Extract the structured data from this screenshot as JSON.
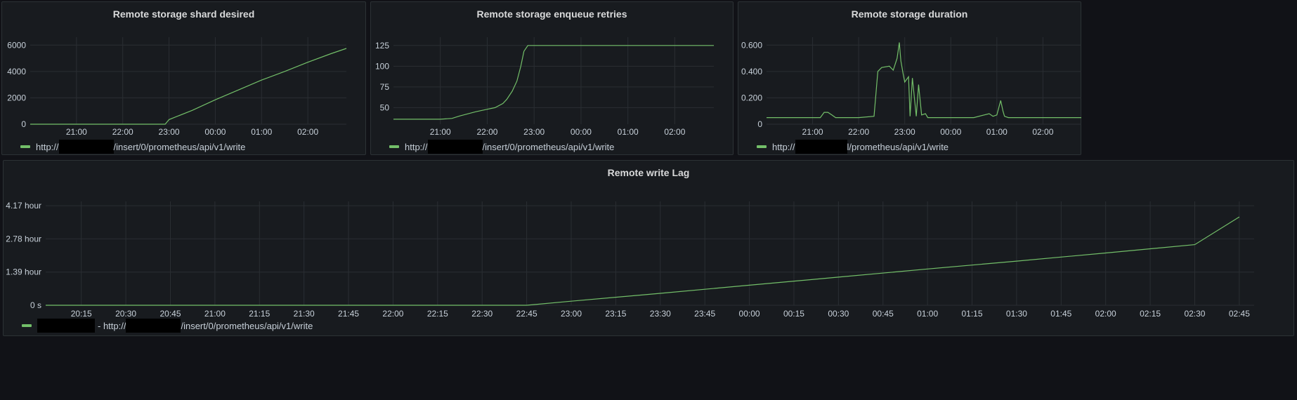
{
  "panels": [
    {
      "id": "shard",
      "title": "Remote storage shard desired",
      "legend": {
        "prefix": "http://",
        "suffix": "/insert/0/prometheus/api/v1/write"
      },
      "chart_data": {
        "type": "line",
        "title": "Remote storage shard desired",
        "xlabel": "",
        "ylabel": "",
        "x_ticks": [
          "21:00",
          "22:00",
          "23:00",
          "00:00",
          "01:00",
          "02:00"
        ],
        "y_ticks": [
          "0",
          "2000",
          "4000",
          "6000"
        ],
        "xlim": [
          "20:00",
          "02:50"
        ],
        "ylim": [
          0,
          6600
        ],
        "grid": true,
        "series": [
          {
            "x": [
              "20:00",
              "21:00",
              "22:00",
              "22:40",
              "22:55",
              "23:00",
              "23:30",
              "00:00",
              "00:30",
              "01:00",
              "01:30",
              "02:00",
              "02:30",
              "02:50"
            ],
            "y": [
              0,
              0,
              0,
              0,
              0,
              350,
              1050,
              1850,
              2600,
              3350,
              4000,
              4700,
              5350,
              5750
            ]
          }
        ]
      }
    },
    {
      "id": "retries",
      "title": "Remote storage enqueue retries",
      "legend": {
        "prefix": "http://",
        "suffix": "/insert/0/prometheus/api/v1/write"
      },
      "chart_data": {
        "type": "line",
        "title": "Remote storage enqueue retries",
        "xlabel": "",
        "ylabel": "",
        "x_ticks": [
          "21:00",
          "22:00",
          "23:00",
          "00:00",
          "01:00",
          "02:00"
        ],
        "y_ticks": [
          "50",
          "75",
          "100",
          "125"
        ],
        "xlim": [
          "20:00",
          "02:50"
        ],
        "ylim": [
          30,
          135
        ],
        "grid": true,
        "series": [
          {
            "x": [
              "20:00",
              "21:00",
              "21:15",
              "21:25",
              "21:45",
              "22:00",
              "22:10",
              "22:20",
              "22:25",
              "22:32",
              "22:38",
              "22:43",
              "22:47",
              "22:52",
              "23:00",
              "00:00",
              "01:00",
              "02:00",
              "02:50"
            ],
            "y": [
              36,
              36,
              37,
              40,
              45,
              48,
              50,
              55,
              60,
              70,
              82,
              100,
              118,
              125,
              125,
              125,
              125,
              125,
              125
            ]
          }
        ]
      }
    },
    {
      "id": "duration",
      "title": "Remote storage duration",
      "legend": {
        "prefix": "http://",
        "suffix": "l/prometheus/api/v1/write"
      },
      "chart_data": {
        "type": "line",
        "title": "Remote storage duration",
        "xlabel": "",
        "ylabel": "",
        "x_ticks": [
          "21:00",
          "22:00",
          "23:00",
          "00:00",
          "01:00",
          "02:00"
        ],
        "y_ticks": [
          "0",
          "0.200",
          "0.400",
          "0.600"
        ],
        "xlim": [
          "20:00",
          "02:50"
        ],
        "ylim": [
          0,
          0.66
        ],
        "grid": true,
        "series": [
          {
            "x": [
              "20:00",
              "20:30",
              "21:00",
              "21:10",
              "21:15",
              "21:20",
              "21:25",
              "21:30",
              "21:40",
              "22:00",
              "22:20",
              "22:25",
              "22:30",
              "22:40",
              "22:45",
              "22:50",
              "22:53",
              "22:55",
              "22:58",
              "23:00",
              "23:05",
              "23:07",
              "23:10",
              "23:15",
              "23:18",
              "23:22",
              "23:27",
              "23:30",
              "23:40",
              "00:00",
              "00:30",
              "00:50",
              "00:55",
              "01:00",
              "01:05",
              "01:08",
              "01:10",
              "01:15",
              "01:30",
              "02:00",
              "02:50"
            ],
            "y": [
              0.05,
              0.05,
              0.05,
              0.05,
              0.09,
              0.09,
              0.07,
              0.05,
              0.05,
              0.05,
              0.06,
              0.4,
              0.43,
              0.44,
              0.41,
              0.5,
              0.62,
              0.48,
              0.38,
              0.32,
              0.36,
              0.06,
              0.35,
              0.06,
              0.3,
              0.07,
              0.08,
              0.05,
              0.05,
              0.05,
              0.05,
              0.08,
              0.06,
              0.07,
              0.18,
              0.1,
              0.06,
              0.05,
              0.05,
              0.05,
              0.05
            ]
          }
        ]
      }
    },
    {
      "id": "lag",
      "title": "Remote write Lag",
      "legend": {
        "prefix": "- http://",
        "suffix": "/insert/0/prometheus/api/v1/write"
      },
      "chart_data": {
        "type": "line",
        "title": "Remote write Lag",
        "xlabel": "",
        "ylabel": "",
        "x_ticks": [
          "20:15",
          "20:30",
          "20:45",
          "21:00",
          "21:15",
          "21:30",
          "21:45",
          "22:00",
          "22:15",
          "22:30",
          "22:45",
          "23:00",
          "23:15",
          "23:30",
          "23:45",
          "00:00",
          "00:15",
          "00:30",
          "00:45",
          "01:00",
          "01:15",
          "01:30",
          "01:45",
          "02:00",
          "02:15",
          "02:30",
          "02:45"
        ],
        "y_ticks": [
          "0 s",
          "1.39 hour",
          "2.78 hour",
          "4.17 hour"
        ],
        "xlim": [
          "20:03",
          "02:50"
        ],
        "ylim": [
          0,
          4.35
        ],
        "grid": true,
        "series": [
          {
            "x": [
              "20:03",
              "22:45",
              "23:00",
              "23:30",
              "00:00",
              "00:30",
              "01:00",
              "01:30",
              "02:00",
              "02:30",
              "02:45"
            ],
            "y": [
              0,
              0,
              0.17,
              0.5,
              0.84,
              1.18,
              1.52,
              1.85,
              2.19,
              2.54,
              3.7
            ]
          }
        ]
      }
    }
  ]
}
